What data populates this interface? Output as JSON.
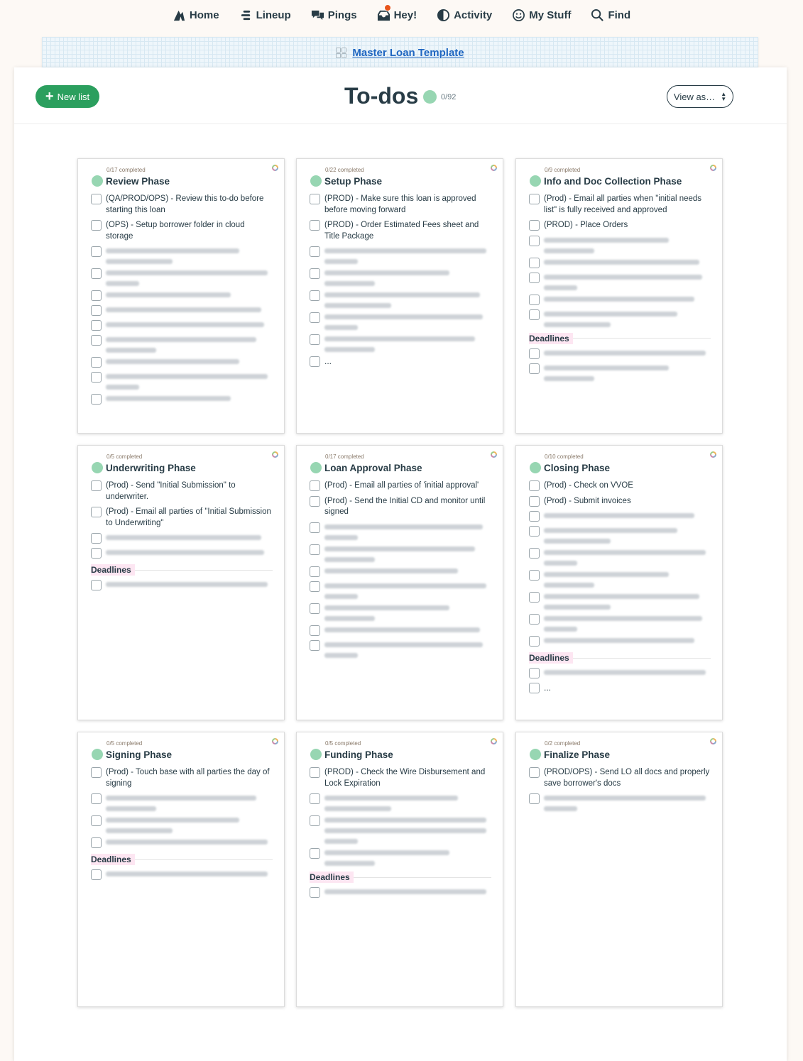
{
  "nav": {
    "items": [
      {
        "key": "home",
        "label": "Home",
        "icon": "home-icon"
      },
      {
        "key": "lineup",
        "label": "Lineup",
        "icon": "lineup-icon"
      },
      {
        "key": "pings",
        "label": "Pings",
        "icon": "pings-icon"
      },
      {
        "key": "hey",
        "label": "Hey!",
        "icon": "hey-icon"
      },
      {
        "key": "activity",
        "label": "Activity",
        "icon": "activity-icon"
      },
      {
        "key": "mystuff",
        "label": "My Stuff",
        "icon": "my-stuff-icon"
      },
      {
        "key": "find",
        "label": "Find",
        "icon": "search-icon"
      }
    ]
  },
  "banner": {
    "project_name": "Master Loan Template",
    "icon": "project-grid-icon"
  },
  "header": {
    "new_list_label": "New list",
    "title": "To-dos",
    "count": "0/92",
    "view_as_label": "View as…"
  },
  "colors": {
    "accent": "#2b9f5e",
    "dot": "#97d6b2",
    "link": "#1f66c1",
    "deadline_bg": "#fde6f2"
  },
  "lists": [
    {
      "id": "review",
      "completed": "0/17 completed",
      "name": "Review Phase",
      "items": [
        {
          "text": "(QA/PROD/OPS) - Review this to-do before starting this loan"
        },
        {
          "text": "(OPS) - Setup borrower folder in cloud storage"
        },
        {
          "text": "(OPS) - Sa",
          "blurred_lines": 2
        },
        {
          "blurred_lines": 2
        },
        {
          "blurred_lines": 1
        },
        {
          "blurred_lines": 1
        },
        {
          "blurred_lines": 1
        },
        {
          "blurred_lines": 2
        },
        {
          "blurred_lines": 1
        },
        {
          "blurred_lines": 2
        },
        {
          "blurred_lines": 1
        }
      ]
    },
    {
      "id": "setup",
      "completed": "0/22 completed",
      "name": "Setup Phase",
      "items": [
        {
          "text": "(PROD) - Make sure this loan is approved before moving forward"
        },
        {
          "text": "(PROD) - Order Estimated Fees sheet and Title Package"
        },
        {
          "blurred_lines": 2
        },
        {
          "blurred_lines": 2
        },
        {
          "blurred_lines": 2
        },
        {
          "blurred_lines": 2
        },
        {
          "blurred_lines": 2
        },
        {
          "text": "..."
        }
      ]
    },
    {
      "id": "info",
      "completed": "0/9 completed",
      "name": "Info and Doc Collection Phase",
      "items": [
        {
          "text": "(Prod) - Email all parties when \"initial needs list\" is fully received and approved"
        },
        {
          "text": "(PROD) - Place Orders"
        },
        {
          "blurred_lines": 2
        },
        {
          "blurred_lines": 1
        },
        {
          "blurred_lines": 2
        },
        {
          "blurred_lines": 1
        },
        {
          "blurred_lines": 2
        }
      ],
      "deadlines_label": "Deadlines",
      "deadline_items": [
        {
          "blurred_lines": 1
        },
        {
          "blurred_lines": 2
        }
      ]
    },
    {
      "id": "underwriting",
      "completed": "0/5 completed",
      "name": "Underwriting Phase",
      "items": [
        {
          "text": "(Prod) - Send \"Initial Submission\" to underwriter."
        },
        {
          "text": "(Prod) - Email all parties of \"Initial Submission to Underwriting\""
        },
        {
          "blurred_lines": 1
        },
        {
          "blurred_lines": 1
        }
      ],
      "deadlines_label": "Deadlines",
      "deadline_items": [
        {
          "blurred_lines": 1
        }
      ]
    },
    {
      "id": "loan-approval",
      "completed": "0/17 completed",
      "name": "Loan Approval Phase",
      "items": [
        {
          "text": "(Prod) - Email all parties of 'initial approval'"
        },
        {
          "text": "(Prod) - Send the Initial CD and monitor until signed"
        },
        {
          "blurred_lines": 2
        },
        {
          "blurred_lines": 2
        },
        {
          "blurred_lines": 1
        },
        {
          "blurred_lines": 2
        },
        {
          "blurred_lines": 2
        },
        {
          "blurred_lines": 1
        },
        {
          "blurred_lines": 2
        }
      ]
    },
    {
      "id": "closing",
      "completed": "0/10 completed",
      "name": "Closing Phase",
      "items": [
        {
          "text": "(Prod) - Check on VVOE"
        },
        {
          "text": "(Prod) - Submit invoices"
        },
        {
          "blurred_lines": 1
        },
        {
          "blurred_lines": 2
        },
        {
          "blurred_lines": 2
        },
        {
          "blurred_lines": 2
        },
        {
          "blurred_lines": 2
        },
        {
          "blurred_lines": 2
        },
        {
          "blurred_lines": 1
        }
      ],
      "deadlines_label": "Deadlines",
      "deadline_items": [
        {
          "blurred_lines": 1
        },
        {
          "text": "..."
        }
      ]
    },
    {
      "id": "signing",
      "completed": "0/5 completed",
      "name": "Signing Phase",
      "items": [
        {
          "text": "(Prod) - Touch base with all parties the day of signing"
        },
        {
          "blurred_lines": 2
        },
        {
          "blurred_lines": 2
        },
        {
          "blurred_lines": 1
        }
      ],
      "deadlines_label": "Deadlines",
      "deadline_items": [
        {
          "blurred_lines": 1
        }
      ]
    },
    {
      "id": "funding",
      "completed": "0/5 completed",
      "name": "Funding Phase",
      "items": [
        {
          "text": "(PROD) - Check the Wire Disbursement and Lock Expiration"
        },
        {
          "blurred_lines": 2
        },
        {
          "blurred_lines": 3
        },
        {
          "blurred_lines": 2
        }
      ],
      "deadlines_label": "Deadlines",
      "deadline_items": [
        {
          "blurred_lines": 1
        }
      ]
    },
    {
      "id": "finalize",
      "completed": "0/2 completed",
      "name": "Finalize Phase",
      "items": [
        {
          "text": "(PROD/OPS) - Send LO all docs and properly save borrower's docs"
        },
        {
          "blurred_lines": 2
        }
      ]
    }
  ]
}
